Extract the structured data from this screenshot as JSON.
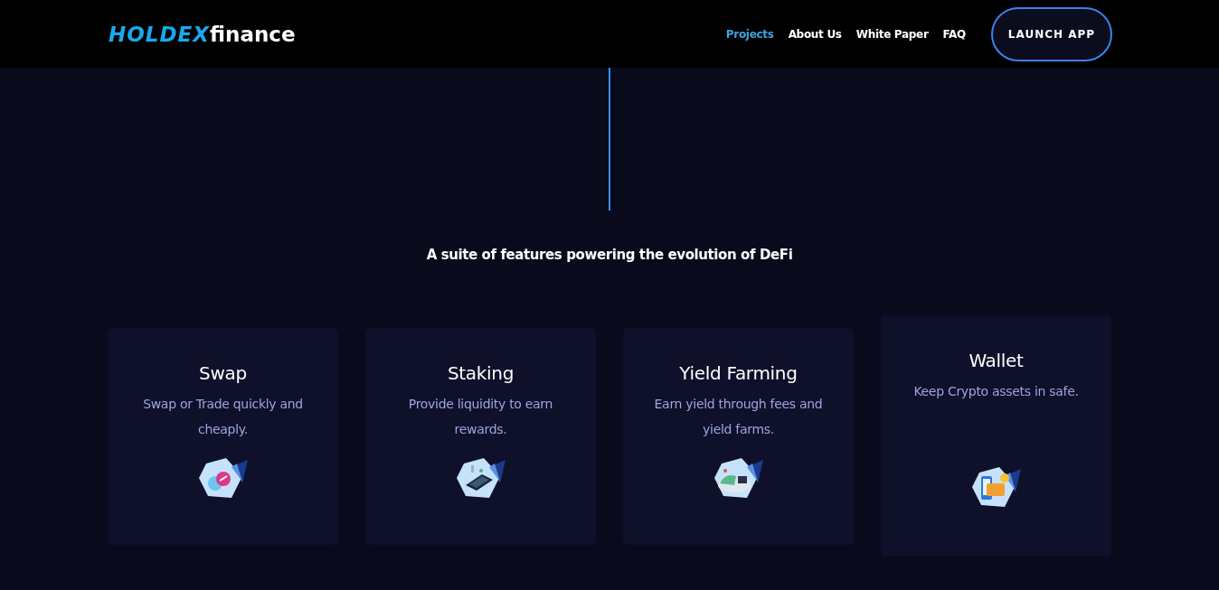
{
  "header": {
    "logo": {
      "brand": "HOLDEX",
      "suffix": "finance"
    },
    "nav": [
      {
        "label": "Projects",
        "selected": true
      },
      {
        "label": "About Us",
        "selected": false
      },
      {
        "label": "White Paper",
        "selected": false
      },
      {
        "label": "FAQ",
        "selected": false
      }
    ],
    "button": "LAUNCH APP"
  },
  "heading": "A suite of features powering the evolution of DeFi",
  "cards": [
    {
      "title": "Swap",
      "text": "Swap or Trade quickly and cheaply.",
      "kind": "swap",
      "raised": false
    },
    {
      "title": "Staking",
      "text": "Provide liquidity to earn rewards.",
      "kind": "staking",
      "raised": false
    },
    {
      "title": "Yield Farming",
      "text": "Earn yield through fees and yield farms.",
      "kind": "farm",
      "raised": false
    },
    {
      "title": "Wallet",
      "text": "Keep Crypto assets in safe.",
      "kind": "wallet",
      "raised": true
    }
  ]
}
